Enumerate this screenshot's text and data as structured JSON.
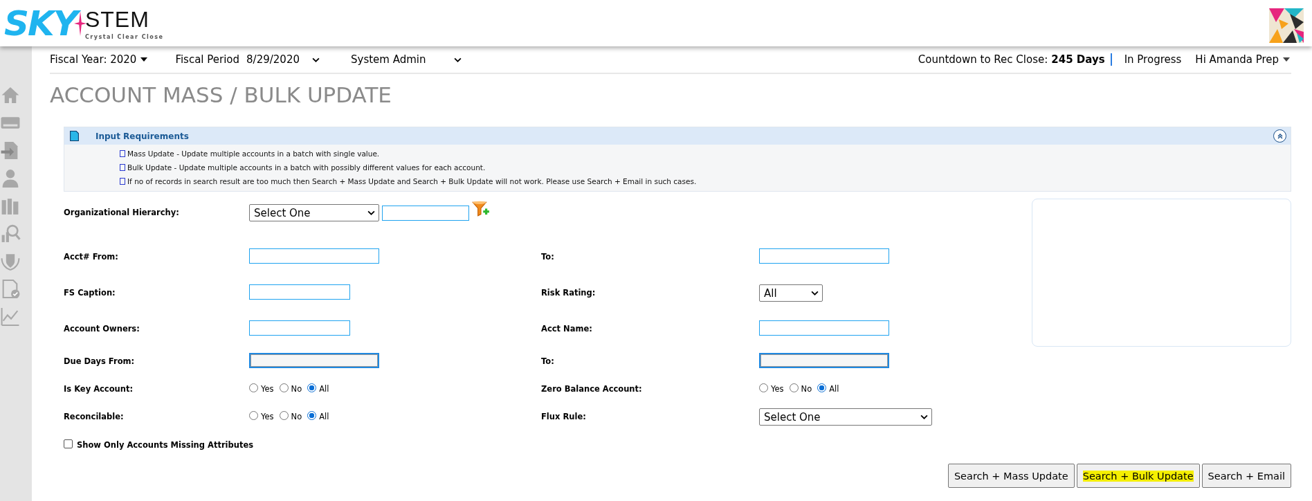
{
  "logo": {
    "brand_left": "SKY",
    "brand_right": "STEM",
    "tagline": "Crystal Clear Close"
  },
  "top_bar": {
    "fiscal_year": "Fiscal Year: 2020",
    "fiscal_period_label": "Fiscal Period",
    "fiscal_period": "8/29/2020",
    "role": "System Admin",
    "countdown_label": "Countdown to Rec Close:",
    "countdown_value": "245 Days",
    "status": "In Progress",
    "user": "Hi Amanda Prep"
  },
  "page_title": "ACCOUNT MASS / BULK UPDATE",
  "info_panel": {
    "title": "Input Requirements",
    "expanded": true,
    "items": [
      "Mass Update - Update multiple accounts in a batch with single value.",
      "Bulk Update - Update multiple accounts in a batch with possibly different values for each account.",
      "If no of records in search result are too much then Search + Mass Update and Search + Bulk Update will not work. Please use Search + Email in such cases."
    ]
  },
  "form": {
    "rows": [
      {
        "left": {
          "label": "Organizational Hierarchy:",
          "kind": "select_filter",
          "value": "Select One"
        }
      },
      {
        "left": {
          "label": "Acct# From:",
          "kind": "text"
        },
        "right": {
          "label": "To:",
          "kind": "text"
        }
      },
      {
        "left": {
          "label": "FS Caption:",
          "kind": "short_text"
        },
        "right": {
          "label": "Risk Rating:",
          "kind": "small_select",
          "value": "All"
        }
      },
      {
        "left": {
          "label": "Account Owners:",
          "kind": "short_text"
        },
        "right": {
          "label": "Acct Name:",
          "kind": "text"
        }
      },
      {
        "left": {
          "label": "Due Days From:",
          "kind": "text",
          "disabled": true
        },
        "right": {
          "label": "To:",
          "kind": "text",
          "disabled": true
        }
      },
      {
        "left": {
          "label": "Is Key Account:",
          "kind": "radio",
          "options": [
            {
              "label": "Yes",
              "selected": false
            },
            {
              "label": "No",
              "selected": false
            },
            {
              "label": "All",
              "selected": true
            }
          ]
        },
        "right": {
          "label": "Zero Balance Account:",
          "kind": "radio",
          "options": [
            {
              "label": "Yes",
              "selected": false
            },
            {
              "label": "No",
              "selected": false
            },
            {
              "label": "All",
              "selected": true
            }
          ]
        }
      },
      {
        "left": {
          "label": "Reconcilable:",
          "kind": "radio",
          "options": [
            {
              "label": "Yes",
              "selected": false
            },
            {
              "label": "No",
              "selected": false
            },
            {
              "label": "All",
              "selected": true
            }
          ]
        },
        "right": {
          "label": "Flux Rule:",
          "kind": "wide_select",
          "value": "Select One"
        }
      }
    ],
    "missing_attributes": {
      "label": "Show Only Accounts Missing Attributes",
      "checked": false
    }
  },
  "buttons": [
    {
      "label": "Search + Mass Update",
      "highlighted": false
    },
    {
      "label": "Search + Bulk Update",
      "highlighted": true
    },
    {
      "label": "Search + Email",
      "highlighted": false
    }
  ]
}
